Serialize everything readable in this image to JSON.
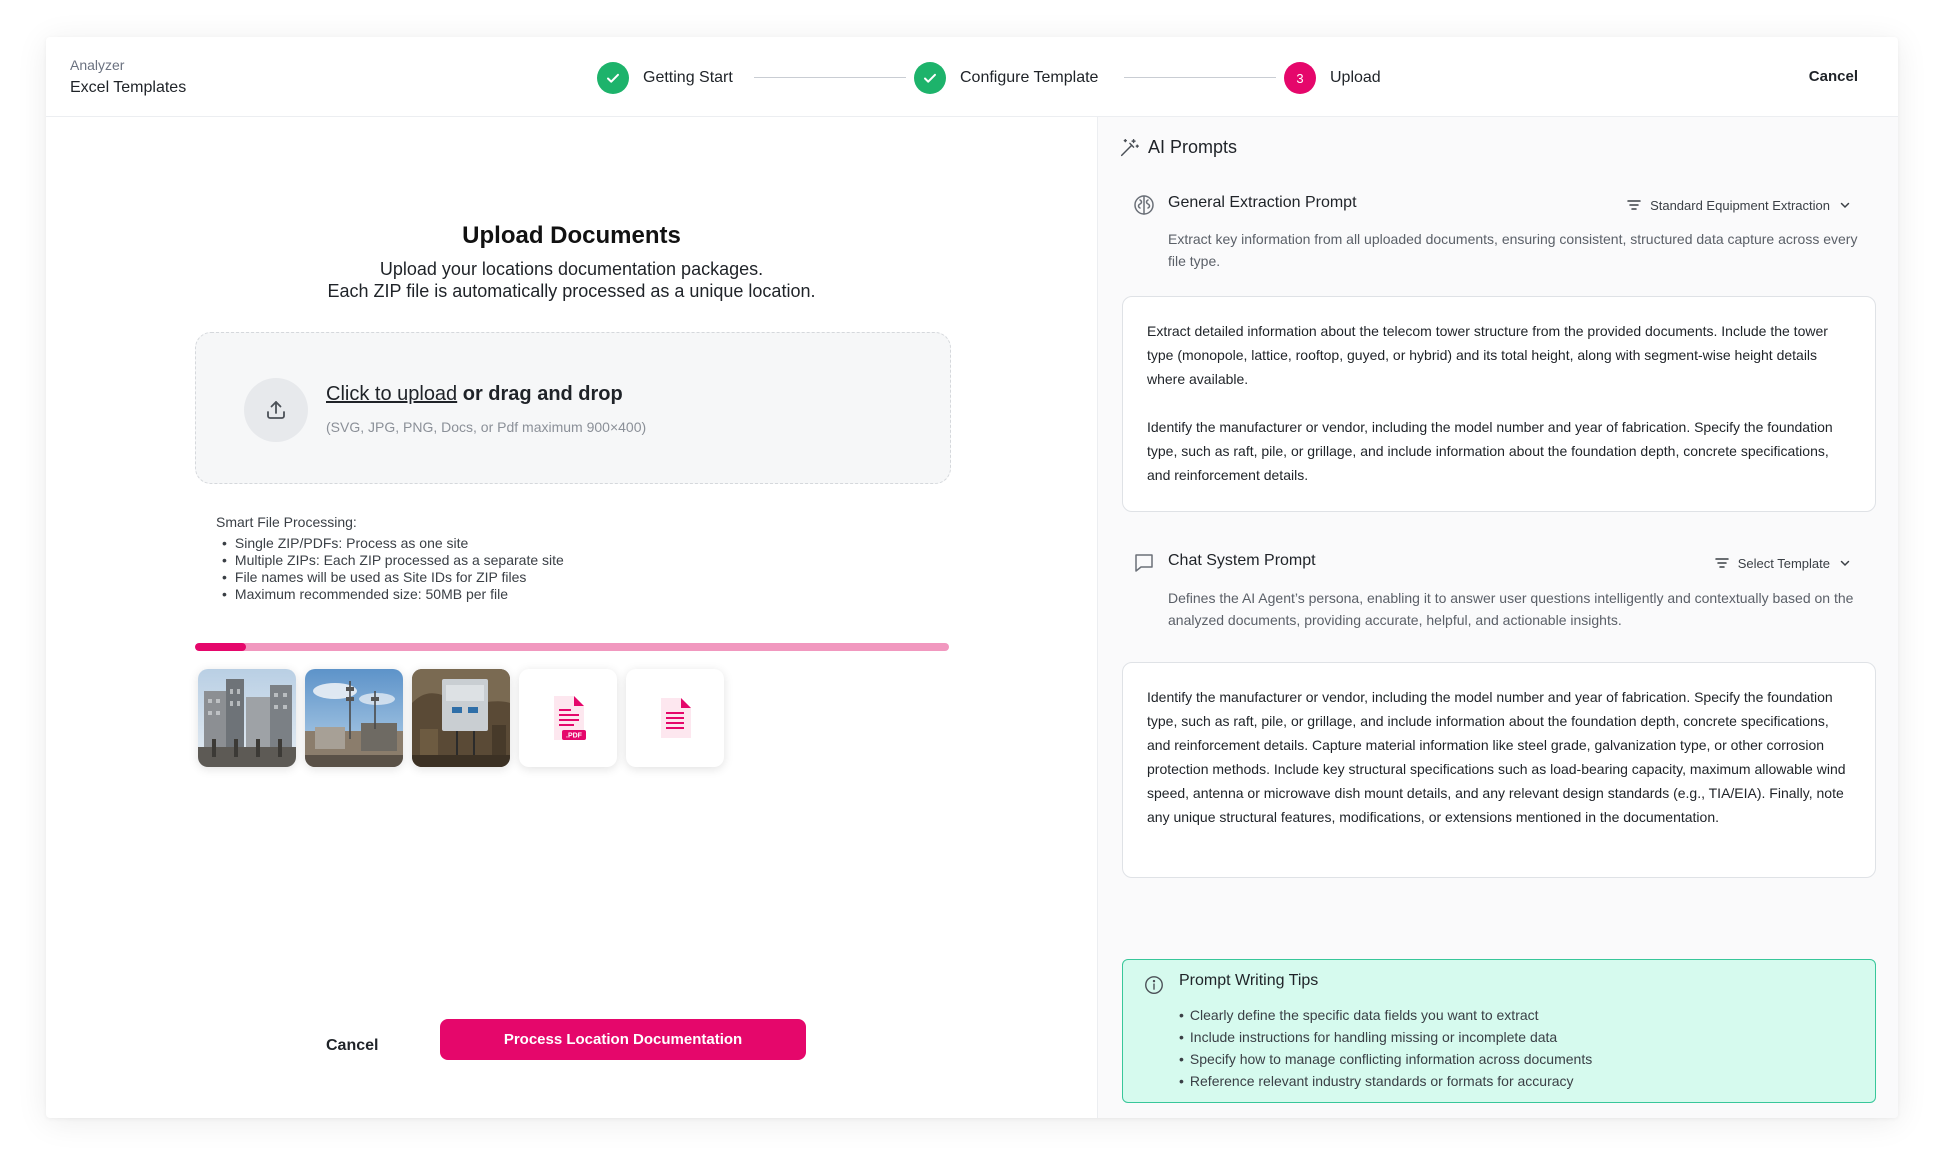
{
  "header": {
    "breadcrumb_parent": "Analyzer",
    "breadcrumb_title": "Excel Templates",
    "steps": [
      {
        "number": "",
        "label": "Getting Start",
        "state": "done"
      },
      {
        "number": "",
        "label": "Configure Template",
        "state": "done"
      },
      {
        "number": "3",
        "label": "Upload",
        "state": "active"
      }
    ],
    "cancel_label": "Cancel"
  },
  "upload": {
    "title": "Upload Documents",
    "subtitle_line1": "Upload your locations documentation packages.",
    "subtitle_line2": "Each ZIP file is automatically processed as a unique location.",
    "drop_link": "Click to upload",
    "drop_rest": " or drag and drop",
    "drop_hint": "(SVG, JPG, PNG, Docs, or Pdf maximum 900×400)",
    "smart_title": "Smart File Processing:",
    "smart_items": [
      "Single ZIP/PDFs: Process as one site",
      "Multiple ZIPs: Each ZIP processed as a separate site",
      "File names will be used as Site IDs for ZIP files",
      "Maximum recommended size: 50MB per file"
    ],
    "progress_fraction": 0.067,
    "files": [
      {
        "kind": "image",
        "icon": "building-photo"
      },
      {
        "kind": "image",
        "icon": "tower-photo"
      },
      {
        "kind": "image",
        "icon": "equipment-photo"
      },
      {
        "kind": "pdf",
        "icon": "pdf-file-icon",
        "badge": ".PDF"
      },
      {
        "kind": "doc",
        "icon": "doc-file-icon"
      }
    ],
    "cancel_label": "Cancel",
    "process_label": "Process Location Documentation"
  },
  "ai": {
    "title": "AI Prompts",
    "general": {
      "title": "General Extraction Prompt",
      "select_value": "Standard Equipment Extraction",
      "description": "Extract key information from all uploaded documents, ensuring consistent, structured data capture across every file type.",
      "prompt_p1": "Extract detailed information about the telecom tower structure from the provided documents. Include the tower type (monopole, lattice, rooftop, guyed, or hybrid) and its total height, along with segment-wise height details where available.",
      "prompt_p2": "Identify the manufacturer or vendor, including the model number and year of fabrication. Specify the foundation type, such as raft, pile, or grillage, and include information about the foundation depth, concrete specifications, and reinforcement details."
    },
    "chat": {
      "title": "Chat System Prompt",
      "select_value": "Select Template",
      "description": "Defines the AI Agent’s persona, enabling it to answer user questions intelligently and contextually based on the analyzed documents, providing accurate, helpful, and actionable insights.",
      "prompt": "Identify the manufacturer or vendor, including the model number and year of fabrication. Specify the foundation type, such as raft, pile, or grillage, and include information about the foundation depth, concrete specifications, and reinforcement details. Capture material information like steel grade, galvanization type, or other corrosion protection methods. Include key structural specifications such as load-bearing capacity, maximum allowable wind speed, antenna or microwave dish mount details, and any relevant design standards (e.g., TIA/EIA). Finally, note any unique structural features, modifications, or extensions mentioned in the documentation."
    },
    "tips": {
      "title": "Prompt Writing Tips",
      "items": [
        "Clearly define the specific data fields you want to extract",
        "Include instructions for handling missing or incomplete data",
        "Specify how to manage conflicting information across documents",
        "Reference relevant industry standards or formats for accuracy"
      ]
    }
  },
  "colors": {
    "accent": "#e5076b",
    "success": "#1db36b",
    "progress_track": "#f198bf",
    "tips_bg": "#d6faee",
    "tips_border": "#38c79a"
  }
}
